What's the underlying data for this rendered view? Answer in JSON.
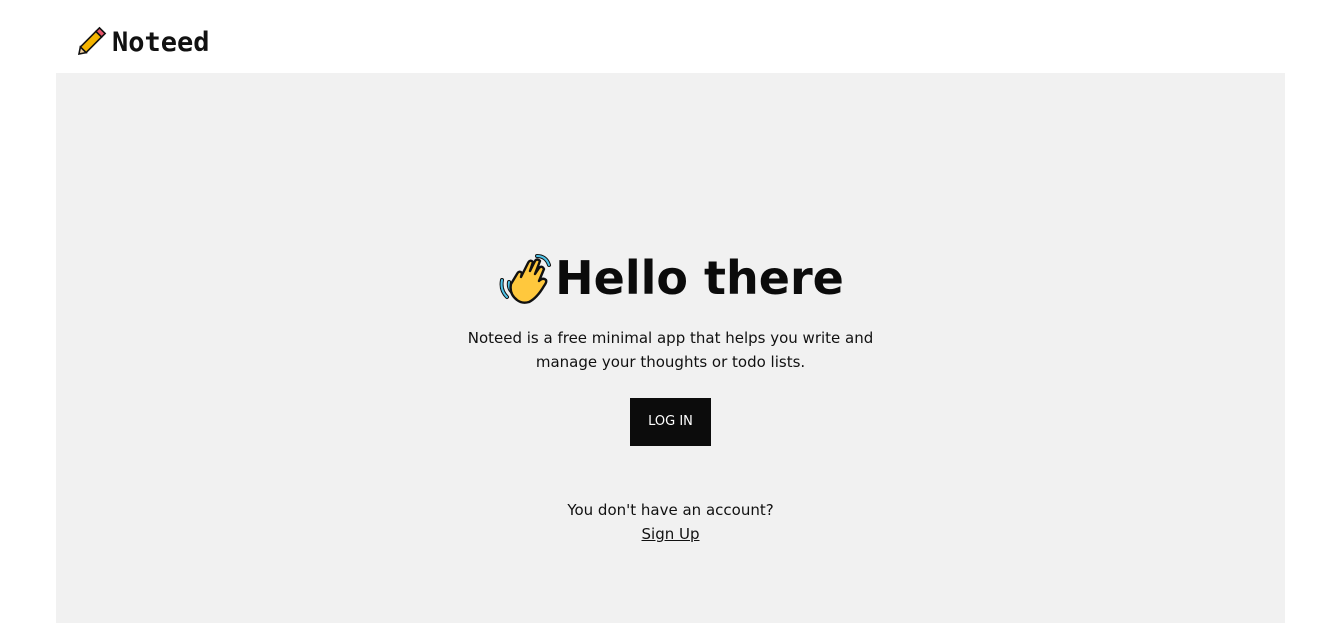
{
  "header": {
    "logo_icon": "pencil-icon",
    "app_name": "Noteed"
  },
  "hero": {
    "icon": "waving-hand-icon",
    "title": "Hello there",
    "description": "Noteed is a free minimal app that helps you write and manage your thoughts or todo lists.",
    "login_label": "LOG IN",
    "account_prompt": "You don't have an account?",
    "signup_label": "Sign Up"
  },
  "colors": {
    "panel_background": "#f1f1f1",
    "button_background": "#0c0c0c",
    "button_text": "#ffffff",
    "text": "#111111"
  }
}
